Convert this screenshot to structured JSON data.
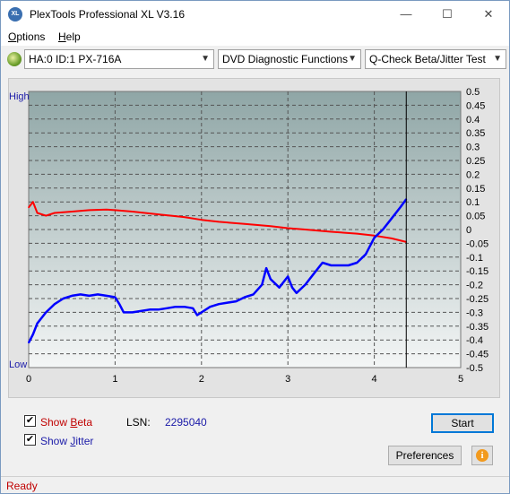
{
  "window": {
    "title": "PlexTools Professional XL V3.16",
    "icon_text": "XL",
    "controls": {
      "minimize": "—",
      "maximize": "☐",
      "close": "✕"
    }
  },
  "menu": {
    "options": {
      "label": "Options",
      "accel": "O",
      "rest": "ptions"
    },
    "help": {
      "label": "Help",
      "accel": "H",
      "rest": "elp"
    }
  },
  "toolbar": {
    "drive": "HA:0 ID:1  PX-716A",
    "function": "DVD Diagnostic Functions",
    "test": "Q-Check Beta/Jitter Test"
  },
  "chart": {
    "left_high": "High",
    "left_low": "Low"
  },
  "chart_data": {
    "type": "line",
    "x_ticks": [
      "0",
      "1",
      "2",
      "3",
      "4",
      "5"
    ],
    "xlim": [
      0,
      5
    ],
    "y_ticks": [
      "0.5",
      "0.45",
      "0.4",
      "0.35",
      "0.3",
      "0.25",
      "0.2",
      "0.15",
      "0.1",
      "0.05",
      "0",
      "-0.05",
      "-0.1",
      "-0.15",
      "-0.2",
      "-0.25",
      "-0.3",
      "-0.35",
      "-0.4",
      "-0.45",
      "-0.5"
    ],
    "ylim": [
      -0.5,
      0.5
    ],
    "grid": true,
    "end_marker_x": 4.37,
    "series": [
      {
        "color": "#ff0000",
        "x": [
          0.0,
          0.05,
          0.1,
          0.2,
          0.3,
          0.5,
          0.7,
          0.9,
          1.0,
          1.2,
          1.5,
          1.8,
          2.0,
          2.2,
          2.5,
          2.8,
          3.0,
          3.2,
          3.5,
          3.8,
          4.0,
          4.2,
          4.37
        ],
        "y": [
          0.08,
          0.1,
          0.06,
          0.05,
          0.06,
          0.065,
          0.07,
          0.072,
          0.07,
          0.065,
          0.055,
          0.045,
          0.035,
          0.028,
          0.02,
          0.012,
          0.005,
          0.0,
          -0.008,
          -0.015,
          -0.022,
          -0.032,
          -0.045
        ]
      },
      {
        "color": "#0000ff",
        "x": [
          0.0,
          0.05,
          0.1,
          0.2,
          0.3,
          0.4,
          0.5,
          0.6,
          0.7,
          0.8,
          0.9,
          1.0,
          1.05,
          1.1,
          1.2,
          1.3,
          1.4,
          1.5,
          1.6,
          1.7,
          1.8,
          1.9,
          1.95,
          2.0,
          2.1,
          2.2,
          2.3,
          2.4,
          2.5,
          2.6,
          2.7,
          2.75,
          2.8,
          2.9,
          3.0,
          3.05,
          3.1,
          3.2,
          3.3,
          3.4,
          3.5,
          3.6,
          3.7,
          3.8,
          3.9,
          4.0,
          4.1,
          4.2,
          4.3,
          4.37
        ],
        "y": [
          -0.41,
          -0.38,
          -0.34,
          -0.3,
          -0.27,
          -0.25,
          -0.24,
          -0.235,
          -0.24,
          -0.235,
          -0.24,
          -0.245,
          -0.27,
          -0.3,
          -0.3,
          -0.295,
          -0.29,
          -0.29,
          -0.285,
          -0.28,
          -0.28,
          -0.285,
          -0.31,
          -0.3,
          -0.28,
          -0.27,
          -0.265,
          -0.26,
          -0.245,
          -0.235,
          -0.2,
          -0.14,
          -0.18,
          -0.21,
          -0.17,
          -0.21,
          -0.23,
          -0.2,
          -0.16,
          -0.12,
          -0.13,
          -0.13,
          -0.13,
          -0.12,
          -0.09,
          -0.03,
          0.0,
          0.04,
          0.08,
          0.11
        ]
      }
    ]
  },
  "options": {
    "show_beta": {
      "text": "Show ",
      "accel": "B",
      "rest": "eta",
      "checked": true,
      "color": "#c00000"
    },
    "show_jitter": {
      "text": "Show ",
      "accel": "J",
      "rest": "itter",
      "checked": true,
      "color": "#1a1aa8"
    }
  },
  "lsn": {
    "label": "LSN:",
    "value": "2295040"
  },
  "buttons": {
    "start": "Start",
    "preferences": "Preferences",
    "info_glyph": "i"
  },
  "status": {
    "text": "Ready",
    "color": "#c00000"
  }
}
